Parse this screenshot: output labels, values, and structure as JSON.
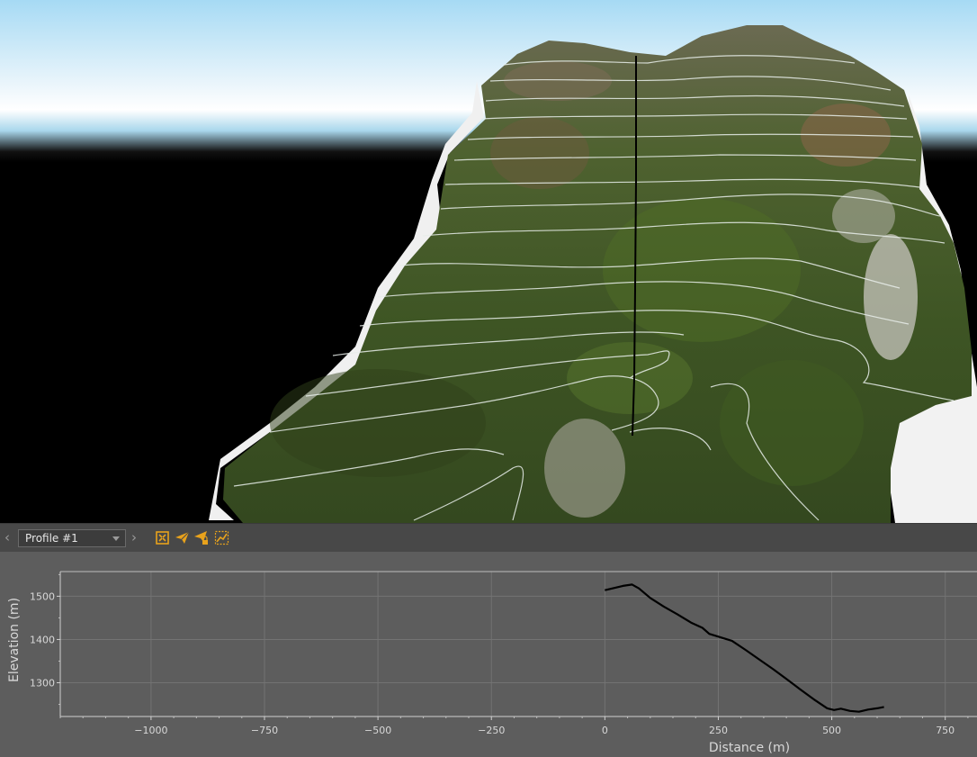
{
  "toolbar": {
    "profile_selected": "Profile #1",
    "prev_icon": "chevron-left-icon",
    "next_icon": "chevron-right-icon",
    "tools": [
      "fit-extent-icon",
      "send-icon",
      "send-lock-icon",
      "line-chart-icon"
    ],
    "accent_color": "#e8a21c"
  },
  "colors": {
    "sky_top": "#a9dcf5",
    "panel_bg": "#5d5d5d",
    "toolbar_bg": "#484848",
    "grid": "#737373",
    "profile_line": "#000000"
  },
  "chart_data": {
    "type": "line",
    "xlabel": "Distance (m)",
    "ylabel": "Elevation (m)",
    "xlim": [
      -1200,
      820
    ],
    "ylim": [
      1222,
      1557
    ],
    "xticks": [
      -1000,
      -750,
      -500,
      -250,
      0,
      250,
      500,
      750
    ],
    "yticks": [
      1300,
      1400,
      1500
    ],
    "grid": true,
    "series": [
      {
        "x": [
          0,
          20,
          40,
          60,
          75,
          100,
          130,
          160,
          190,
          215,
          230,
          255,
          280,
          310,
          340,
          370,
          400,
          430,
          460,
          490,
          505,
          520,
          540,
          560,
          580,
          600,
          615
        ],
        "y": [
          1514,
          1519,
          1524,
          1527,
          1518,
          1496,
          1476,
          1458,
          1439,
          1427,
          1413,
          1405,
          1397,
          1376,
          1354,
          1332,
          1309,
          1285,
          1262,
          1241,
          1237,
          1240,
          1235,
          1233,
          1238,
          1241,
          1244
        ]
      }
    ]
  }
}
